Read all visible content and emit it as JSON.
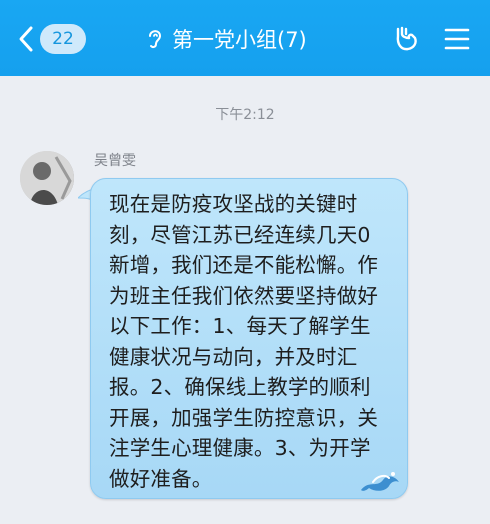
{
  "header": {
    "back_count": "22",
    "title": "第一党小组(7)",
    "icons": [
      "chevron-left-icon",
      "ear-icon",
      "hand-sign-icon",
      "menu-icon"
    ]
  },
  "chat": {
    "time": "下午2:12",
    "messages": [
      {
        "sender": "吴曾雯",
        "text": "现在是防疫攻坚战的关键时刻，尽管江苏已经连续几天0新增，我们还是不能松懈。作为班主任我们依然要坚持做好以下工作：1、每天了解学生健康状况与动向，并及时汇报。2、确保线上教学的顺利开展，加强学生防控意识，关注学生心理健康。3、为开学做好准备。"
      }
    ]
  },
  "colors": {
    "header": "#19a7f3",
    "bubble": "#b5e0f9",
    "background": "#ebeef3"
  }
}
